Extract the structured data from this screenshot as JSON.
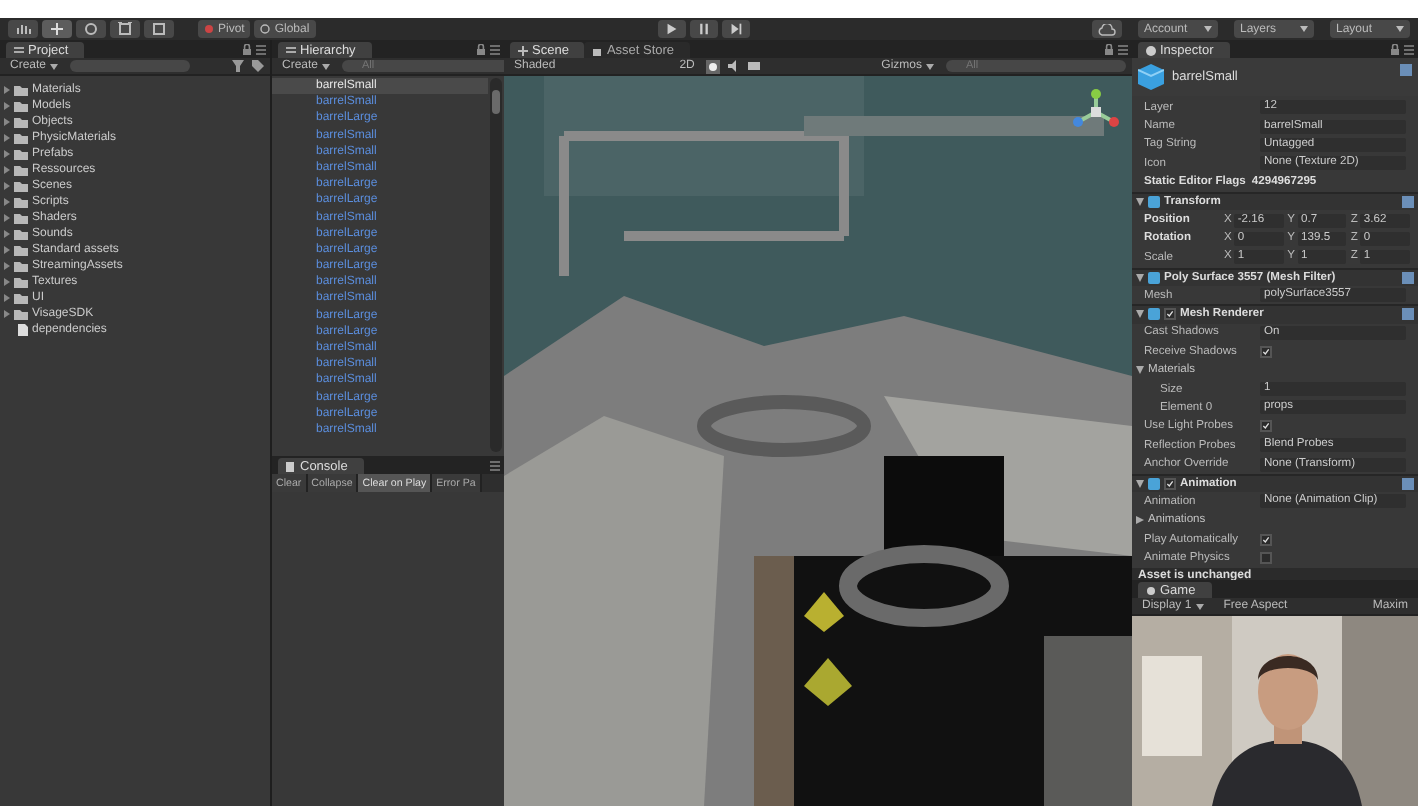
{
  "toolbar": {
    "pivot": "Pivot",
    "global": "Global",
    "menus": [
      "Account",
      "Layers",
      "Layout"
    ]
  },
  "project": {
    "tab": "Project",
    "create": "Create",
    "items": [
      {
        "name": "Materials",
        "kind": "folder"
      },
      {
        "name": "Models",
        "kind": "folder"
      },
      {
        "name": "Objects",
        "kind": "folder"
      },
      {
        "name": "PhysicMaterials",
        "kind": "folder"
      },
      {
        "name": "Prefabs",
        "kind": "folder"
      },
      {
        "name": "Ressources",
        "kind": "folder"
      },
      {
        "name": "Scenes",
        "kind": "folder"
      },
      {
        "name": "Scripts",
        "kind": "folder"
      },
      {
        "name": "Shaders",
        "kind": "folder"
      },
      {
        "name": "Sounds",
        "kind": "folder"
      },
      {
        "name": "Standard assets",
        "kind": "folder"
      },
      {
        "name": "StreamingAssets",
        "kind": "folder"
      },
      {
        "name": "Textures",
        "kind": "folder"
      },
      {
        "name": "UI",
        "kind": "folder"
      },
      {
        "name": "VisageSDK",
        "kind": "folder"
      },
      {
        "name": "dependencies",
        "kind": "file"
      }
    ]
  },
  "hierarchy": {
    "tab": "Hierarchy",
    "create": "Create",
    "search_placeholder": "All",
    "items": [
      {
        "name": "barrelSmall",
        "selected": true
      },
      {
        "name": "barrelSmall",
        "selected": false
      },
      {
        "name": "barrelLarge",
        "selected": false
      },
      {
        "name": "barrelSmall",
        "selected": false
      },
      {
        "name": "barrelSmall",
        "selected": false
      },
      {
        "name": "barrelSmall",
        "selected": false
      },
      {
        "name": "barrelLarge",
        "selected": false
      },
      {
        "name": "barrelLarge",
        "selected": false
      },
      {
        "name": "barrelSmall",
        "selected": false
      },
      {
        "name": "barrelLarge",
        "selected": false
      },
      {
        "name": "barrelLarge",
        "selected": false
      },
      {
        "name": "barrelLarge",
        "selected": false
      },
      {
        "name": "barrelSmall",
        "selected": false
      },
      {
        "name": "barrelSmall",
        "selected": false
      },
      {
        "name": "barrelLarge",
        "selected": false
      },
      {
        "name": "barrelLarge",
        "selected": false
      },
      {
        "name": "barrelSmall",
        "selected": false
      },
      {
        "name": "barrelSmall",
        "selected": false
      },
      {
        "name": "barrelSmall",
        "selected": false
      },
      {
        "name": "barrelLarge",
        "selected": false
      },
      {
        "name": "barrelLarge",
        "selected": false
      },
      {
        "name": "barrelSmall",
        "selected": false
      }
    ]
  },
  "console": {
    "tab": "Console",
    "buttons": [
      {
        "label": "Clear",
        "on": false
      },
      {
        "label": "Collapse",
        "on": false
      },
      {
        "label": "Clear on Play",
        "on": true
      },
      {
        "label": "Error Pa",
        "on": false
      }
    ]
  },
  "scene": {
    "tabs": [
      {
        "label": "Scene",
        "selected": true
      },
      {
        "label": "Asset Store",
        "selected": false
      }
    ],
    "shading": "Shaded",
    "mode": "2D",
    "gizmos": "Gizmos",
    "search_placeholder": "All"
  },
  "inspector": {
    "tab": "Inspector",
    "object_name": "barrelSmall",
    "rows": [
      {
        "kind": "field",
        "label": "Layer",
        "value": "12"
      },
      {
        "kind": "field",
        "label": "Name",
        "value": "barrelSmall"
      },
      {
        "kind": "field",
        "label": "Tag String",
        "value": "Untagged"
      },
      {
        "kind": "field",
        "label": "Icon",
        "value": "None (Texture 2D)"
      },
      {
        "kind": "flags",
        "label": "Static Editor Flags",
        "value": "4294967295"
      },
      {
        "kind": "component",
        "label": "Transform",
        "expanded": true
      },
      {
        "kind": "vector",
        "label": "Position",
        "bold": true,
        "axes": [
          {
            "axis": "X",
            "value": "-2.16"
          },
          {
            "axis": "Y",
            "value": "0.7"
          },
          {
            "axis": "Z",
            "value": "3.62"
          }
        ]
      },
      {
        "kind": "vector",
        "label": "Rotation",
        "bold": true,
        "axes": [
          {
            "axis": "X",
            "value": "0"
          },
          {
            "axis": "Y",
            "value": "139.5"
          },
          {
            "axis": "Z",
            "value": "0"
          }
        ]
      },
      {
        "kind": "vector",
        "label": "Scale",
        "bold": false,
        "axes": [
          {
            "axis": "X",
            "value": "1"
          },
          {
            "axis": "Y",
            "value": "1"
          },
          {
            "axis": "Z",
            "value": "1"
          }
        ]
      },
      {
        "kind": "component",
        "label": "Poly Surface 3557 (Mesh Filter)",
        "expanded": true
      },
      {
        "kind": "field",
        "label": "Mesh",
        "value": "polySurface3557"
      },
      {
        "kind": "component",
        "label": "Mesh Renderer",
        "expanded": true,
        "enabled": true
      },
      {
        "kind": "field",
        "label": "Cast Shadows",
        "value": "On"
      },
      {
        "kind": "check",
        "label": "Receive Shadows",
        "checked": true
      },
      {
        "kind": "section",
        "label": "Materials",
        "expanded": true
      },
      {
        "kind": "subfield",
        "label": "Size",
        "value": "1"
      },
      {
        "kind": "subfield",
        "label": "Element 0",
        "value": "props"
      },
      {
        "kind": "check",
        "label": "Use Light Probes",
        "checked": true
      },
      {
        "kind": "field",
        "label": "Reflection Probes",
        "value": "Blend Probes"
      },
      {
        "kind": "field",
        "label": "Anchor Override",
        "value": "None (Transform)"
      },
      {
        "kind": "component",
        "label": "Animation",
        "expanded": true,
        "enabled": true
      },
      {
        "kind": "field",
        "label": "Animation",
        "value": "None (Animation Clip)"
      },
      {
        "kind": "section",
        "label": "Animations",
        "expanded": false
      },
      {
        "kind": "check",
        "label": "Play Automatically",
        "checked": true
      },
      {
        "kind": "check",
        "label": "Animate Physics",
        "checked": false
      }
    ],
    "status": "Asset is unchanged"
  },
  "game": {
    "tab": "Game",
    "display": "Display 1",
    "aspect": "Free Aspect",
    "maximize": "Maxim"
  }
}
